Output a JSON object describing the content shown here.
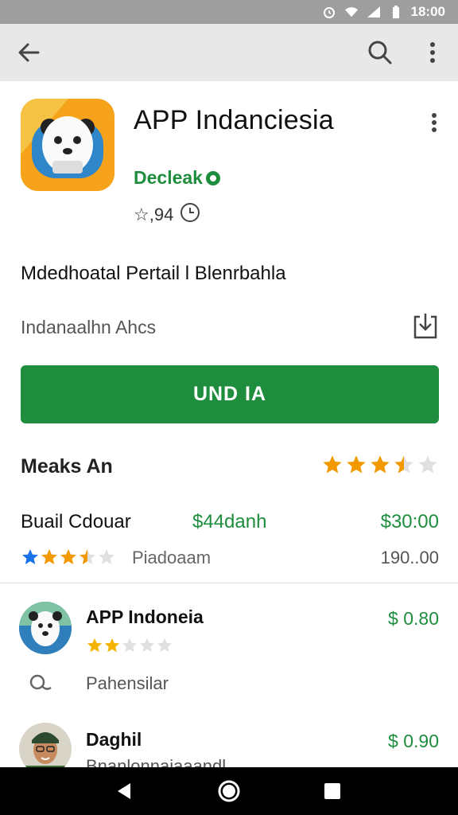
{
  "status_bar": {
    "time": "18:00"
  },
  "app": {
    "title": "APP Indanciesia",
    "developer": "Decleak",
    "rating": "☆,94",
    "description": "Mdedhoatal Pertail l Blenrbahla",
    "sub_text": "Indanaalhn Ahcs",
    "install_label": "UND IA"
  },
  "section": {
    "title": "Meaks An",
    "stars": 3.5
  },
  "price_row": {
    "name": "Buail Cdouar",
    "mid_value": "$44danh",
    "price": "$30:00"
  },
  "rating_line": {
    "stars": 3.5,
    "label": "Piadoaam",
    "value": "190..00"
  },
  "list": [
    {
      "name": "APP Indoneia",
      "price": "$ 0.80",
      "stars": 2
    },
    {
      "name": "Daghil",
      "price": "$ 0.90",
      "sub_text": "Bnanlonnaiaaandl"
    }
  ],
  "sub_item": {
    "label": "Pahensilar"
  },
  "colors": {
    "accent": "#1e8e3e",
    "star_orange": "#f29900",
    "star_blue": "#1a73e8",
    "app_bar": "#e8e8e8",
    "status_bar": "#9e9e9e"
  },
  "icons": [
    "wifi-icon",
    "signal-icon",
    "battery-icon",
    "alarm-icon",
    "back-arrow-icon",
    "search-icon",
    "more-vert-icon",
    "download-icon",
    "star-icon",
    "verified-icon",
    "clock-icon",
    "person-icon",
    "nav-back-icon",
    "nav-home-icon",
    "nav-recents-icon"
  ]
}
